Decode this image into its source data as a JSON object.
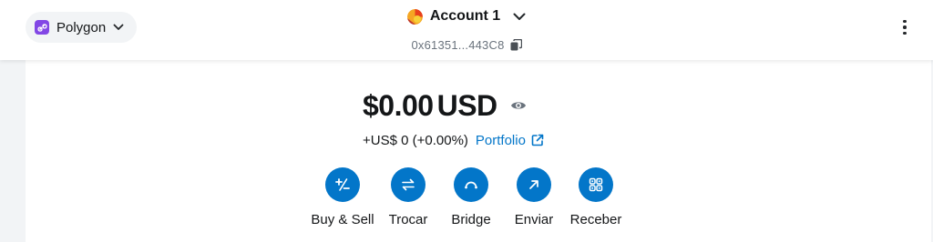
{
  "network": {
    "name": "Polygon",
    "icon": "polygon-network-icon",
    "color": "#8247e5"
  },
  "account": {
    "name": "Account 1",
    "address": "0x61351...443C8"
  },
  "balance": {
    "value": "$0.00",
    "currency": "USD"
  },
  "change": {
    "text": "+US$ 0 (+0.00%)",
    "portfolio_label": "Portfolio"
  },
  "actions": [
    {
      "label": "Buy & Sell",
      "icon": "buy-sell-icon"
    },
    {
      "label": "Trocar",
      "icon": "swap-icon"
    },
    {
      "label": "Bridge",
      "icon": "bridge-icon"
    },
    {
      "label": "Enviar",
      "icon": "send-icon"
    },
    {
      "label": "Receber",
      "icon": "receive-qr-icon"
    }
  ],
  "colors": {
    "accent": "#0376c9",
    "text": "#141618",
    "muted": "#6a737d"
  }
}
